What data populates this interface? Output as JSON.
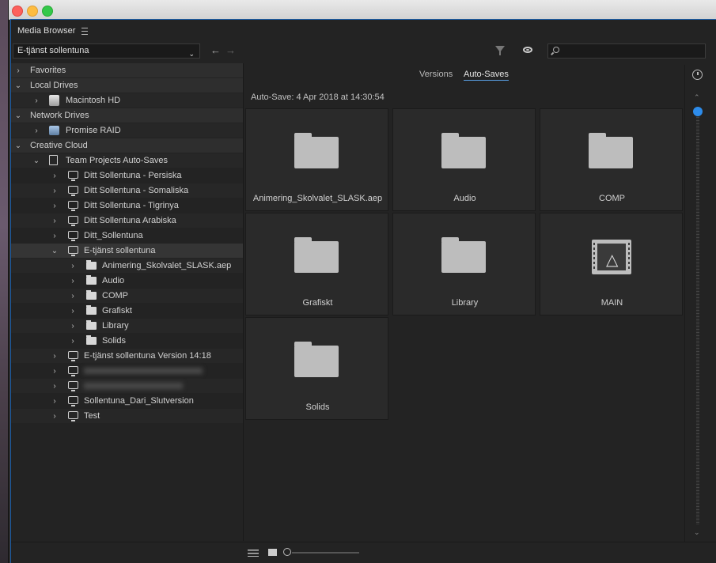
{
  "panel": {
    "title": "Media Browser"
  },
  "toolbar": {
    "location_dropdown": "E-tjänst sollentuna",
    "search_placeholder": ""
  },
  "tree": {
    "favorites": "Favorites",
    "local_drives": "Local Drives",
    "macintosh_hd": "Macintosh HD",
    "network_drives": "Network Drives",
    "promise_raid": "Promise RAID",
    "creative_cloud": "Creative Cloud",
    "team_projects": "Team Projects Auto-Saves",
    "projects": [
      "Ditt Sollentuna - Persiska",
      "Ditt Sollentuna - Somaliska",
      "Ditt Sollentuna - Tigrinya",
      "Ditt Sollentuna Arabiska",
      "Ditt_Sollentuna",
      "E-tjänst sollentuna"
    ],
    "subfolders": [
      "Animering_Skolvalet_SLASK.aep",
      "Audio",
      "COMP",
      "Grafiskt",
      "Library",
      "Solids"
    ],
    "more_projects": [
      "E-tjänst sollentuna Version 14:18",
      "Sollentuna_Dari_Slutversion",
      "Test"
    ]
  },
  "tabs": {
    "versions": "Versions",
    "autosaves": "Auto-Saves"
  },
  "autosave_label": "Auto-Save: 4 Apr 2018 at 14:30:54",
  "grid": {
    "items": [
      "Animering_Skolvalet_SLASK.aep",
      "Audio",
      "COMP",
      "Grafiskt",
      "Library",
      "MAIN",
      "Solids"
    ]
  },
  "colors": {
    "accent": "#2d8ceb",
    "panel_border": "#1c5ea8"
  }
}
